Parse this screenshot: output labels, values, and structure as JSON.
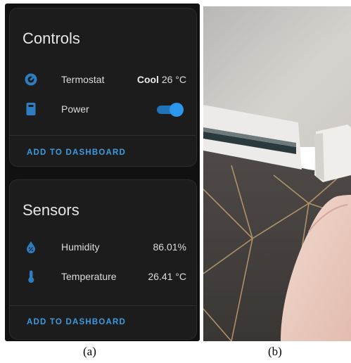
{
  "controls": {
    "title": "Controls",
    "thermostat": {
      "label": "Termostat",
      "mode": "Cool",
      "value": "26 °C"
    },
    "power": {
      "label": "Power",
      "on": true
    },
    "add_label": "ADD TO DASHBOARD"
  },
  "sensors": {
    "title": "Sensors",
    "humidity": {
      "label": "Humidity",
      "value": "86.01%"
    },
    "temperature": {
      "label": "Temperature",
      "value": "26.41 °C"
    },
    "add_label": "ADD TO DASHBOARD"
  },
  "captions": {
    "a": "(a)",
    "b": "(b)"
  },
  "colors": {
    "accent": "#2b97ee",
    "card_bg": "#1c1c1c",
    "panel_bg": "#111111"
  },
  "icons": {
    "thermostat": "thermostat-dial-icon",
    "power": "remote-device-icon",
    "humidity": "water-drop-percent-icon",
    "temperature": "thermometer-icon"
  }
}
